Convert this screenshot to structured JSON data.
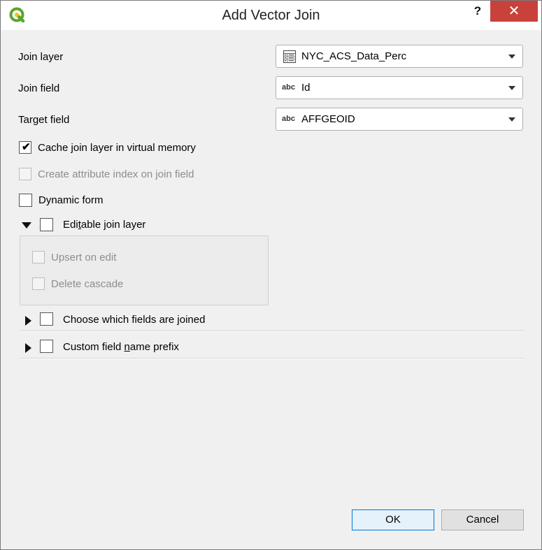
{
  "window": {
    "title": "Add Vector Join",
    "help": "?",
    "close": "✕"
  },
  "fields": {
    "join_layer": {
      "label": "Join layer",
      "value": "NYC_ACS_Data_Perc",
      "icon": "table-icon"
    },
    "join_field": {
      "label": "Join field",
      "value": "Id",
      "type_tag": "abc"
    },
    "target_field": {
      "label": "Target field",
      "value": "AFFGEOID",
      "type_tag": "abc"
    }
  },
  "options": {
    "cache": {
      "label": "Cache join layer in virtual memory",
      "checked": true
    },
    "create_index": {
      "label": "Create attribute index on join field",
      "checked": false,
      "enabled": false
    },
    "dynamic_form": {
      "label": "Dynamic form",
      "checked": false
    }
  },
  "editable_group": {
    "label_pre": "Edi",
    "label_u": "t",
    "label_post": "able join layer",
    "expanded": true,
    "checked": false,
    "upsert": "Upsert on edit",
    "delete_cascade": "Delete cascade"
  },
  "choose_fields_group": {
    "label": "Choose which fields are joined",
    "expanded": false,
    "checked": false
  },
  "prefix_group": {
    "label_pre": "Custom field ",
    "label_u": "n",
    "label_post": "ame prefix",
    "expanded": false,
    "checked": false
  },
  "buttons": {
    "ok": "OK",
    "cancel": "Cancel"
  }
}
